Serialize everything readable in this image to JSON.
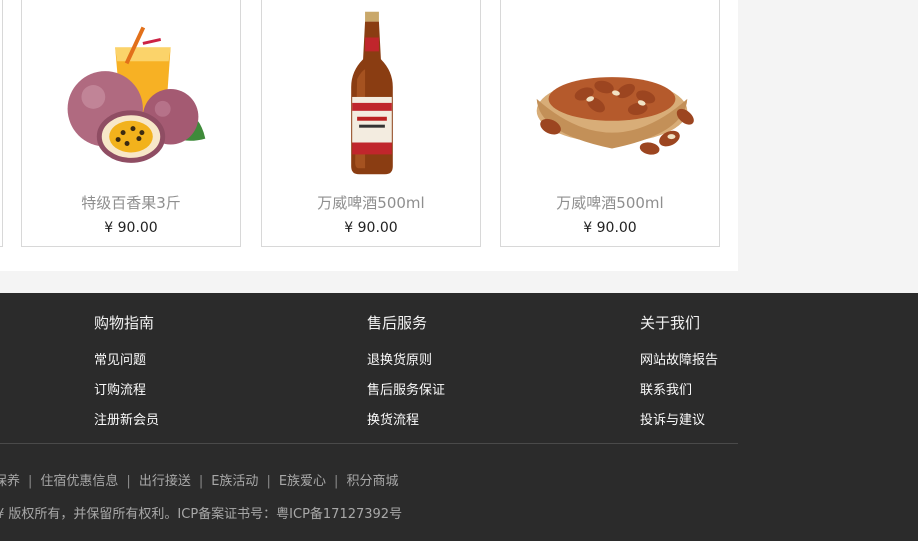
{
  "products": [
    {
      "name": "特级百香果3斤",
      "price": "¥ 90.00",
      "image": "passion-fruit-image"
    },
    {
      "name": "万威啤酒500ml",
      "price": "¥ 90.00",
      "image": "beer-bottle-image"
    },
    {
      "name": "万威啤酒500ml",
      "price": "¥ 90.00",
      "image": "pine-nuts-image"
    }
  ],
  "footer": {
    "columns": [
      {
        "title": "购物指南",
        "links": [
          "常见问题",
          "订购流程",
          "注册新会员"
        ]
      },
      {
        "title": "售后服务",
        "links": [
          "退换货原则",
          "售后服务保证",
          "换货流程"
        ]
      },
      {
        "title": "关于我们",
        "links": [
          "网站故障报告",
          "联系我们",
          "投诉与建议"
        ]
      }
    ],
    "bottom_links": [
      "保养",
      "住宿优惠信息",
      "出行接送",
      "E族活动",
      "E族爱心",
      "积分商城"
    ],
    "separator": "|",
    "copyright": "¥ 版权所有，并保留所有权利。ICP备案证书号：粤ICP备17127392号"
  },
  "colors": {
    "footer_bg": "#2b2b2b",
    "page_bg": "#f4f4f4",
    "product_name": "#8f8f8f",
    "price": "#222222"
  }
}
